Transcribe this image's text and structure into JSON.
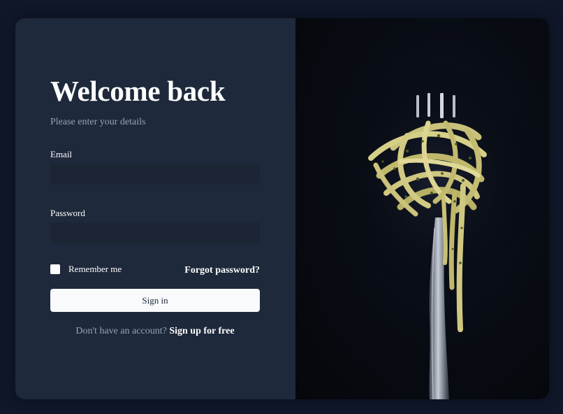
{
  "login": {
    "title": "Welcome back",
    "subtitle": "Please enter your details",
    "email_label": "Email",
    "email_value": "",
    "password_label": "Password",
    "password_value": "",
    "remember_label": "Remember me",
    "remember_checked": false,
    "forgot_link": "Forgot password?",
    "signin_button": "Sign in",
    "signup_prompt": "Don't have an account?",
    "signup_link": "Sign up for free"
  },
  "image": {
    "subject": "pasta-on-fork-photo"
  },
  "colors": {
    "page_background": "#0f1729",
    "card_background": "#1e293b",
    "muted_text": "#94a3b8",
    "button_background": "#f8fafc"
  }
}
